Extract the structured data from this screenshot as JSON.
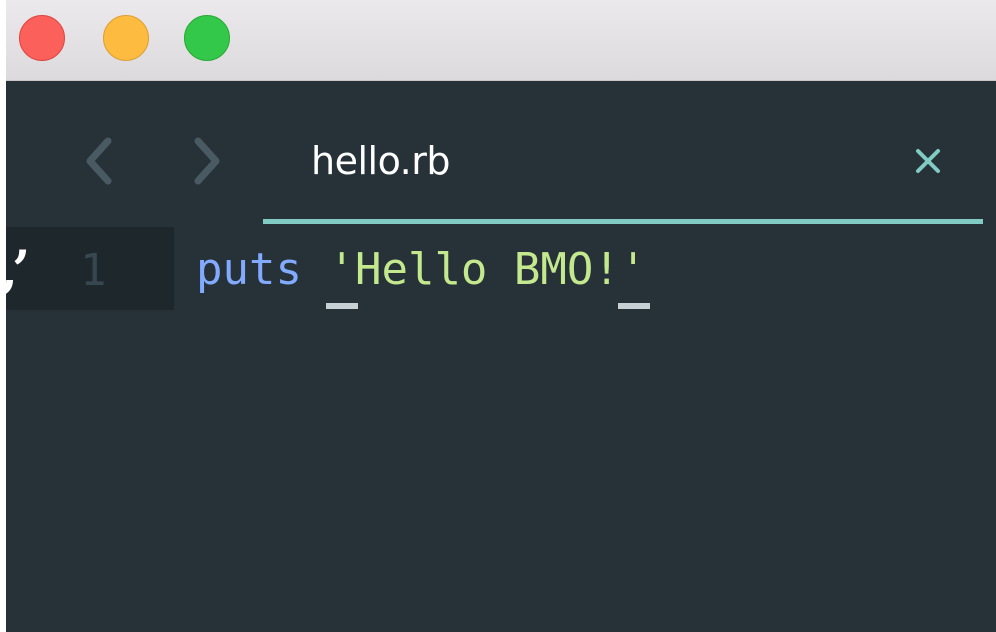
{
  "window": {
    "traffic_lights": {
      "close_color": "#fc605b",
      "minimize_color": "#fdbc40",
      "zoom_color": "#34c84a"
    }
  },
  "tabbar": {
    "back_icon": "chevron-left-icon",
    "forward_icon": "chevron-right-icon",
    "active_tab": {
      "title": "hello.rb",
      "close_icon": "close-icon",
      "underline_color": "#80cbc4"
    }
  },
  "editor": {
    "gutter": {
      "line_number": "1"
    },
    "lines": [
      {
        "keyword": "puts",
        "space": " ",
        "open_quote": "'",
        "string_body": "Hello BMO!",
        "close_quote": "'"
      }
    ],
    "colors": {
      "background": "#263238",
      "keyword": "#82aaff",
      "string": "#c3e88d"
    }
  }
}
